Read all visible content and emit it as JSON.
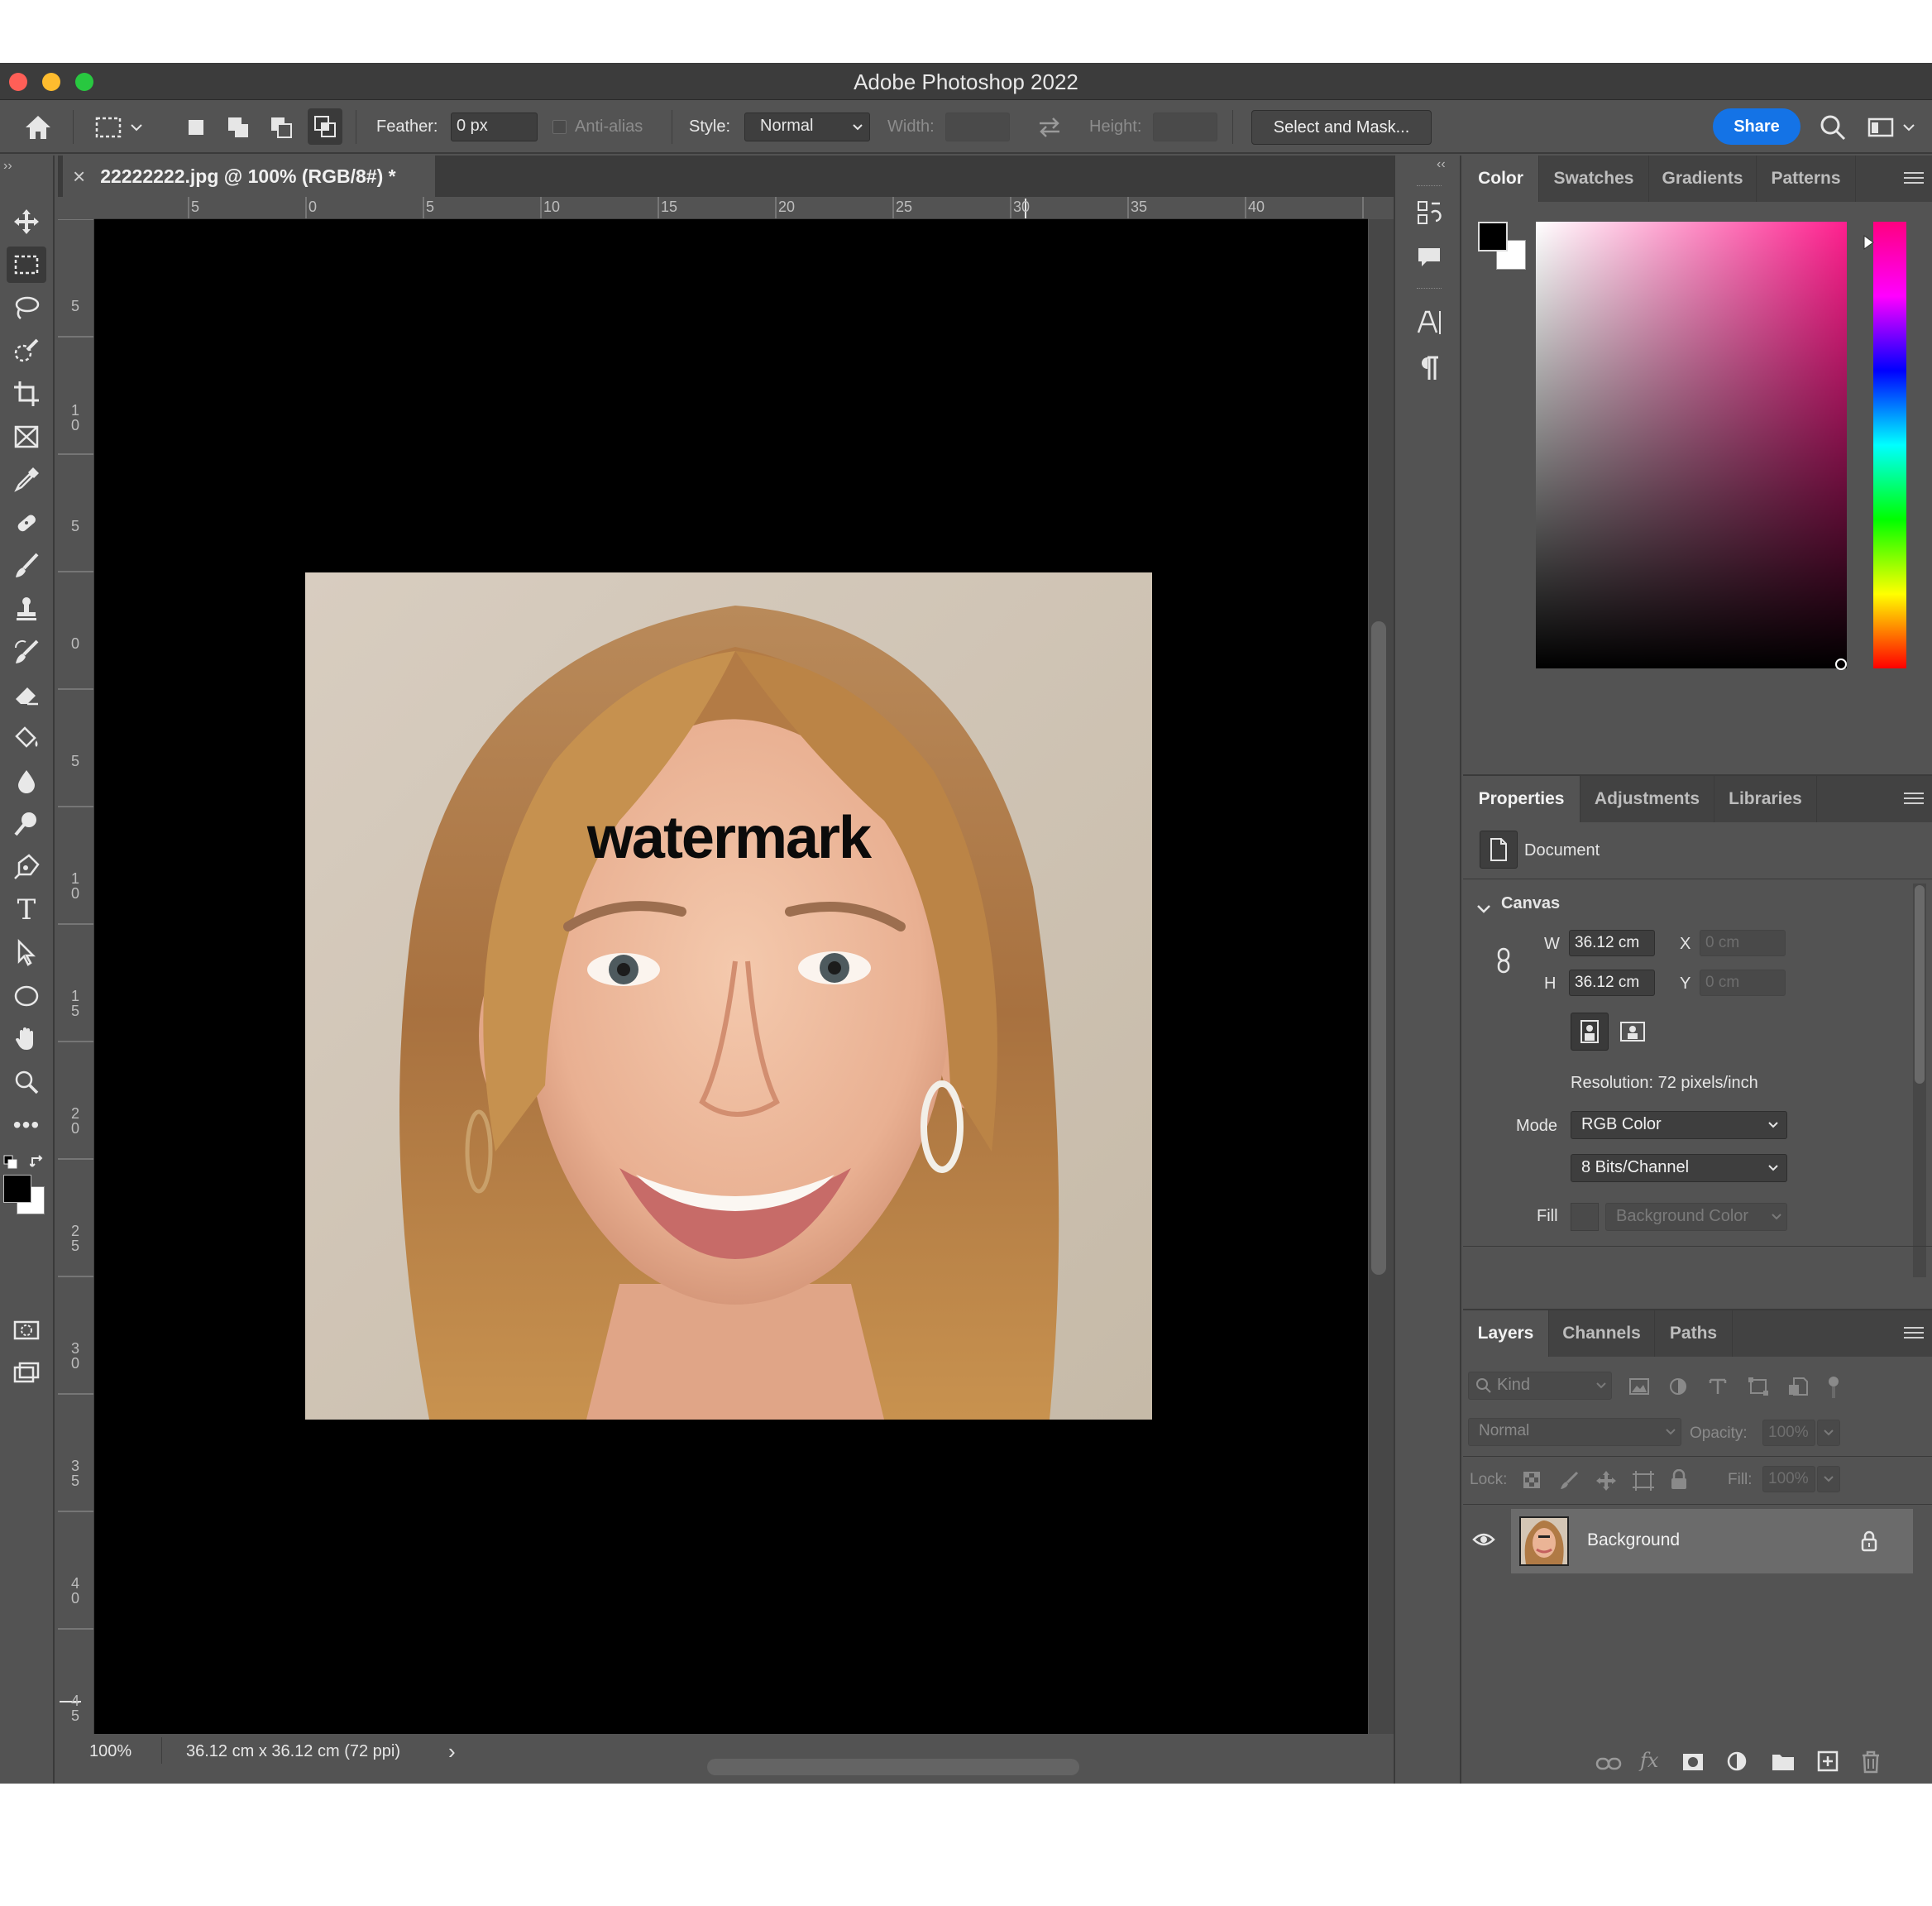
{
  "window": {
    "title": "Adobe Photoshop 2022",
    "traffic_colors": [
      "#ff5f57",
      "#febc2e",
      "#28c840"
    ]
  },
  "options_bar": {
    "feather_label": "Feather:",
    "feather_value": "0 px",
    "antialias_label": "Anti-alias",
    "style_label": "Style:",
    "style_value": "Normal",
    "width_label": "Width:",
    "height_label": "Height:",
    "select_mask_label": "Select and Mask...",
    "share_label": "Share"
  },
  "document": {
    "tab_title": "22222222.jpg @ 100% (RGB/8#) *",
    "close_glyph": "×",
    "watermark_text": "watermark",
    "ruler_top_labels": [
      "5",
      "0",
      "5",
      "10",
      "15",
      "20",
      "25",
      "30",
      "35",
      "40"
    ],
    "ruler_left_labels": [
      "5",
      "1\n0",
      "5",
      "0",
      "5",
      "1\n0",
      "1\n5",
      "2\n0",
      "2\n5",
      "3\n0",
      "3\n5",
      "4\n0",
      "4\n5"
    ]
  },
  "status_bar": {
    "zoom": "100%",
    "doc_size": "36.12 cm x 36.12 cm (72 ppi)",
    "arrow": "›"
  },
  "color_panel": {
    "tabs": [
      "Color",
      "Swatches",
      "Gradients",
      "Patterns"
    ],
    "active_tab": "Color",
    "foreground": "#000000",
    "background": "#ffffff",
    "hue_color": "#ff1f8e"
  },
  "properties_panel": {
    "tabs": [
      "Properties",
      "Adjustments",
      "Libraries"
    ],
    "active_tab": "Properties",
    "document_label": "Document",
    "canvas_label": "Canvas",
    "w_label": "W",
    "w_value": "36.12 cm",
    "h_label": "H",
    "h_value": "36.12 cm",
    "x_label": "X",
    "x_placeholder": "0 cm",
    "y_label": "Y",
    "y_placeholder": "0 cm",
    "resolution": "Resolution: 72 pixels/inch",
    "mode_label": "Mode",
    "mode_value": "RGB Color",
    "bits_value": "8 Bits/Channel",
    "fill_label": "Fill",
    "fill_value": "Background Color"
  },
  "layers_panel": {
    "tabs": [
      "Layers",
      "Channels",
      "Paths"
    ],
    "active_tab": "Layers",
    "kind_label": "Kind",
    "blend_mode": "Normal",
    "opacity_label": "Opacity:",
    "opacity_value": "100%",
    "lock_label": "Lock:",
    "fill_label": "Fill:",
    "fill_value": "100%",
    "layers": [
      {
        "name": "Background",
        "visible": true,
        "locked": true
      }
    ]
  }
}
